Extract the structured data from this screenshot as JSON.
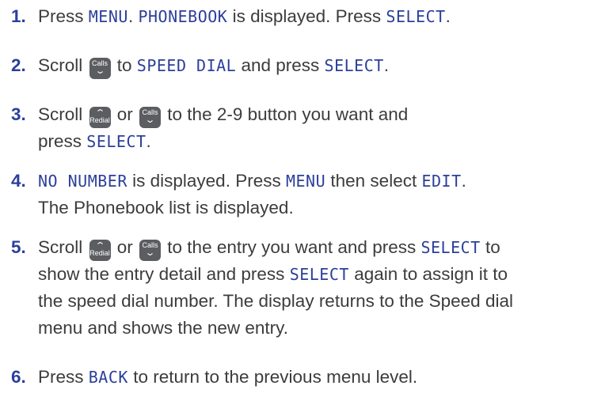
{
  "steps": [
    {
      "num": "1",
      "parts": {
        "a": "Press ",
        "b": "MENU",
        "c": ". ",
        "d": "PHONEBOOK",
        "e": " is displayed. Press ",
        "f": "SELECT",
        "g": "."
      }
    },
    {
      "num": "2",
      "parts": {
        "a": "Scroll ",
        "calls_key": "Calls",
        "b": " to ",
        "c": "SPEED DIAL",
        "d": " and press ",
        "e": "SELECT",
        "f": "."
      }
    },
    {
      "num": "3",
      "parts": {
        "a": "Scroll ",
        "redial_key": "Redial",
        "b": " or ",
        "calls_key": "Calls",
        "c": " to the 2-9 button you want and",
        "d": "press ",
        "e": "SELECT",
        "f": "."
      }
    },
    {
      "num": "4",
      "parts": {
        "a": "NO NUMBER",
        "b": " is displayed. Press ",
        "c": "MENU",
        "d": " then select ",
        "e": "EDIT",
        "f": ".",
        "g": "The Phonebook list is displayed."
      }
    },
    {
      "num": "5",
      "parts": {
        "a": "Scroll ",
        "redial_key": "Redial",
        "b": " or ",
        "calls_key": "Calls",
        "c": " to the entry you want and press ",
        "d": "SELECT",
        "e": " to",
        "f": "show the entry detail and press ",
        "g": "SELECT",
        "h": " again to assign it to",
        "i": "the speed dial number. The display returns to the Speed dial",
        "j": "menu and shows the new entry."
      }
    },
    {
      "num": "6",
      "parts": {
        "a": "Press ",
        "b": "BACK",
        "c": " to return to the previous menu level."
      }
    }
  ],
  "colors": {
    "accent": "#2b3f9a",
    "text": "#3c3c3c",
    "key_bg": "#5b5d60"
  },
  "icons": {
    "up_key": "chevron-up-icon",
    "down_key": "chevron-down-icon"
  }
}
